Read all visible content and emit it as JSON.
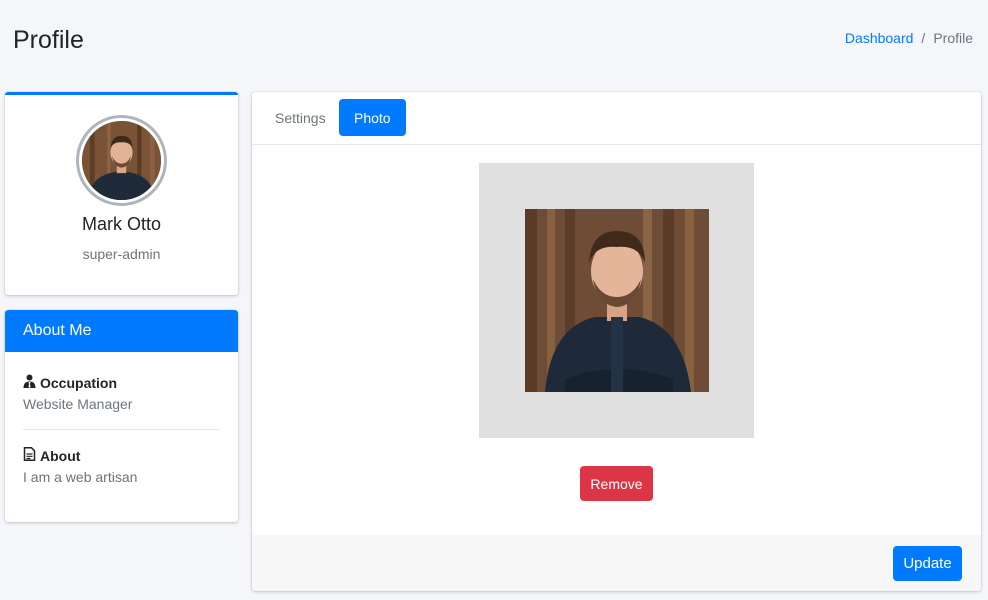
{
  "header": {
    "title": "Profile",
    "breadcrumb": {
      "link": "Dashboard",
      "separator": "/",
      "current": "Profile"
    }
  },
  "profile": {
    "name": "Mark Otto",
    "role": "super-admin",
    "avatar_icon": "user-photo"
  },
  "about": {
    "title": "About Me",
    "items": [
      {
        "label": "Occupation",
        "value": "Website Manager",
        "icon": "user-tie-icon"
      },
      {
        "label": "About",
        "value": "I am a web artisan",
        "icon": "file-text-icon"
      }
    ]
  },
  "tabs": [
    {
      "label": "Settings",
      "active": false
    },
    {
      "label": "Photo",
      "active": true
    }
  ],
  "photo_panel": {
    "remove_label": "Remove",
    "update_label": "Update"
  },
  "colors": {
    "primary": "#007bff",
    "danger": "#dc3545",
    "background": "#f4f6f9"
  }
}
